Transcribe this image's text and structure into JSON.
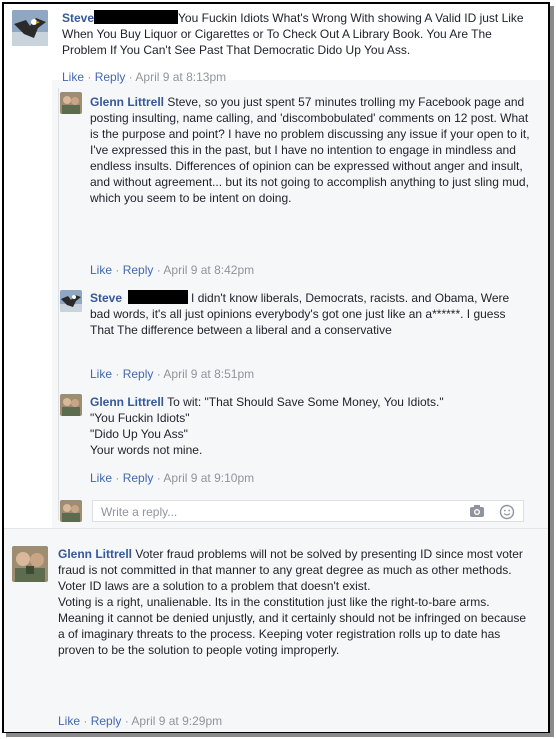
{
  "comments": [
    {
      "author": "Steve",
      "text": "You Fuckin Idiots What's Wrong With showing A Valid ID just Like When You Buy Liquor or Cigarettes or To Check Out A Library Book. You Are The Problem If You Can't See Past That Democratic Dido Up You Ass.",
      "like": "Like",
      "reply": "Reply",
      "sep": "·",
      "time": "April 9 at 8:13pm",
      "avatar_icon": "eagle-avatar"
    },
    {
      "author": "Glenn Littrell",
      "text": "Steve, so you just spent 57 minutes trolling my Facebook page and posting insulting, name calling, and 'discombobulated' comments on 12 post. What is the purpose and point? I have no problem discussing any issue if your open to it, I've expressed this in the past, but I have no intention to engage in mindless and endless insults. Differences of opinion can be expressed without anger and insult, and without agreement... but its not going to accomplish anything to just sling mud, which you seem to be intent on doing.",
      "like": "Like",
      "reply": "Reply",
      "sep": "·",
      "time": "April 9 at 8:42pm",
      "avatar_icon": "profile-photo-avatar"
    },
    {
      "author": "Steve",
      "text": "I didn't know liberals, Democrats, racists. and Obama, Were bad words, it's all just opinions everybody's got one just like an a******. I guess That The difference between a liberal and a conservative",
      "like": "Like",
      "reply": "Reply",
      "sep": "·",
      "time": "April 9 at 8:51pm",
      "avatar_icon": "eagle-avatar"
    },
    {
      "author": "Glenn Littrell",
      "text": "To wit: \"That Should Save Some Money, You Idiots.\"",
      "lines": [
        "\"You Fuckin Idiots\"",
        "\"Dido Up You Ass\"",
        "Your words not mine."
      ],
      "like": "Like",
      "reply": "Reply",
      "sep": "·",
      "time": "April 9 at 9:10pm",
      "avatar_icon": "profile-photo-avatar"
    },
    {
      "author": "Glenn Littrell",
      "text": "Voter fraud problems will not be solved by presenting ID since most voter fraud is not committed in that manner to any great degree as much as other methods. Voter ID laws are a solution to a problem that doesn't exist.",
      "text2": "Voting is a right, unalienable. Its in the constitution just like the right-to-bare arms. Meaning it cannot be denied unjustly, and it certainly should not be infringed on because a of imaginary threats to the process. Keeping voter registration rolls up to date has proven to be the solution to people voting improperly.",
      "like": "Like",
      "reply": "Reply",
      "sep": "·",
      "time": "April 9 at 9:29pm",
      "avatar_icon": "profile-photo-avatar"
    }
  ],
  "reply_box": {
    "placeholder": "Write a reply...",
    "camera_icon": "camera-icon",
    "emoji_icon": "emoji-icon"
  },
  "colors": {
    "name": "#365899",
    "link": "#4267b2",
    "meta": "#90949c",
    "text": "#1d2129",
    "thread_bg": "#f6f7f9"
  }
}
